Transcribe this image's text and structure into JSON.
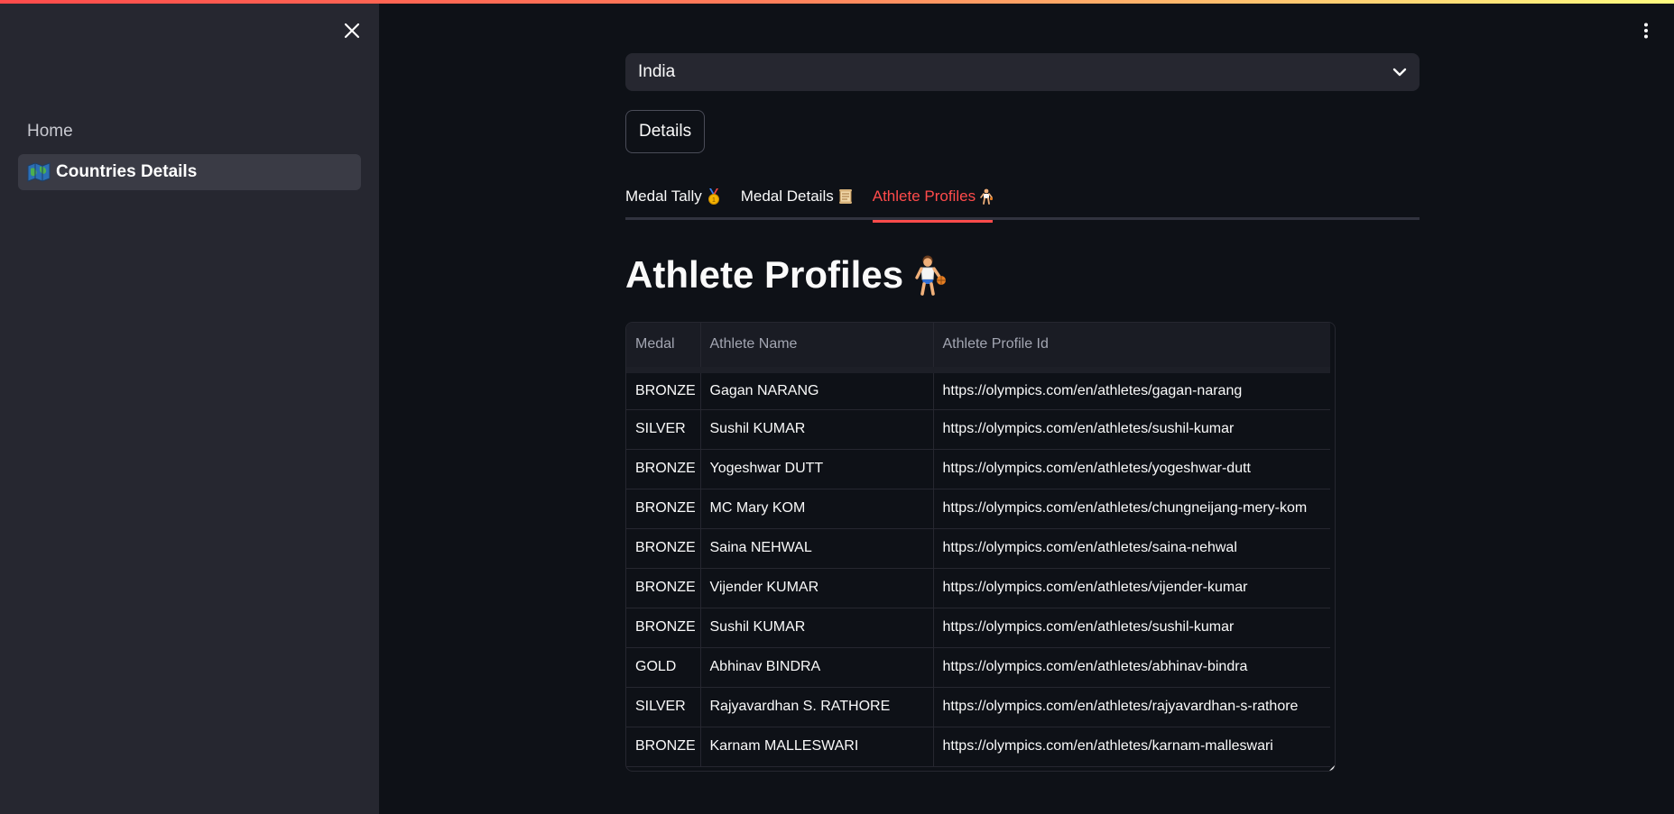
{
  "sidebar": {
    "items": [
      {
        "label": "Home",
        "icon": "none"
      },
      {
        "label": "Countries Details",
        "icon": "map-icon"
      }
    ]
  },
  "select": {
    "value": "India"
  },
  "buttons": {
    "details": "Details"
  },
  "tabs": [
    {
      "label": "Medal Tally",
      "icon": "medal-icon"
    },
    {
      "label": "Medal Details",
      "icon": "scroll-icon"
    },
    {
      "label": "Athlete Profiles",
      "icon": "athlete-icon",
      "active": true
    }
  ],
  "heading": {
    "title": "Athlete Profiles"
  },
  "table": {
    "columns": [
      "Medal",
      "Athlete Name",
      "Athlete Profile Id"
    ],
    "rows": [
      [
        "BRONZE",
        "Gagan NARANG",
        "https://olympics.com/en/athletes/gagan-narang"
      ],
      [
        "SILVER",
        "Sushil KUMAR",
        "https://olympics.com/en/athletes/sushil-kumar"
      ],
      [
        "BRONZE",
        "Yogeshwar DUTT",
        "https://olympics.com/en/athletes/yogeshwar-dutt"
      ],
      [
        "BRONZE",
        "MC Mary KOM",
        "https://olympics.com/en/athletes/chungneijang-mery-kom"
      ],
      [
        "BRONZE",
        "Saina NEHWAL",
        "https://olympics.com/en/athletes/saina-nehwal"
      ],
      [
        "BRONZE",
        "Vijender KUMAR",
        "https://olympics.com/en/athletes/vijender-kumar"
      ],
      [
        "BRONZE",
        "Sushil KUMAR",
        "https://olympics.com/en/athletes/sushil-kumar"
      ],
      [
        "GOLD",
        "Abhinav BINDRA",
        "https://olympics.com/en/athletes/abhinav-bindra"
      ],
      [
        "SILVER",
        "Rajyavardhan S. RATHORE",
        "https://olympics.com/en/athletes/rajyavardhan-s-rathore"
      ],
      [
        "BRONZE",
        "Karnam MALLESWARI",
        "https://olympics.com/en/athletes/karnam-malleswari"
      ]
    ]
  },
  "colors": {
    "accent": "#ff4b4b",
    "background": "#0e1117",
    "sidebar": "#262730"
  }
}
